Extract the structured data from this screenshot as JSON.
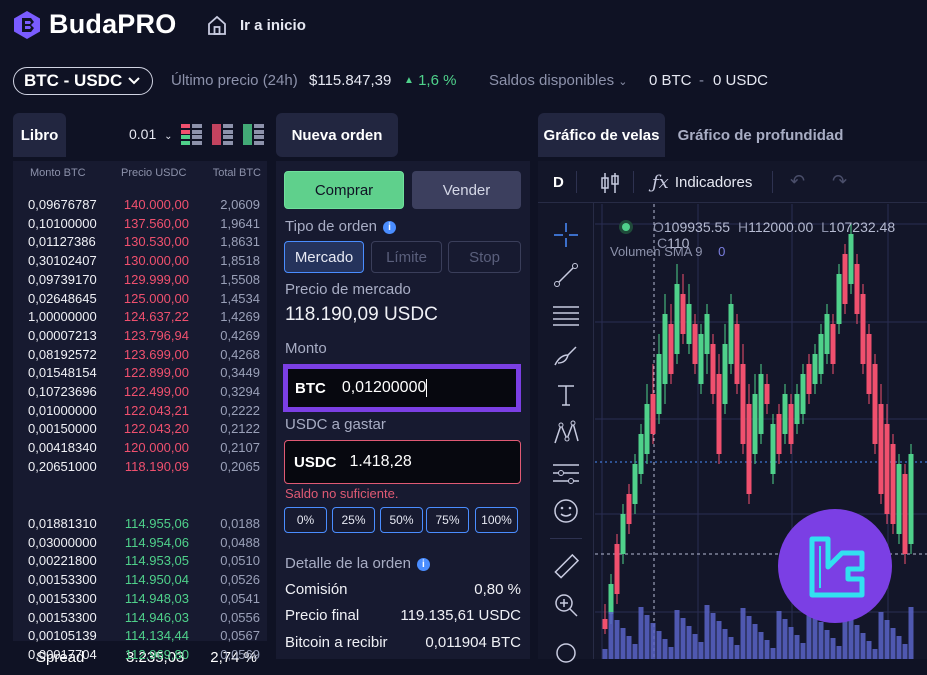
{
  "header": {
    "brand": "BudaPRO",
    "home_label": "Ir a inicio"
  },
  "market": {
    "pair": "BTC - USDC",
    "last_price_label": "Último precio (24h)",
    "last_price": "$115.847,39",
    "change": "1,6 %",
    "balances_label": "Saldos disponibles",
    "balance_btc": "0 BTC",
    "separator": "-",
    "balance_usdc": "0 USDC"
  },
  "book": {
    "tab": "Libro",
    "precision": "0.01",
    "columns": [
      "Monto BTC",
      "Precio USDC",
      "Total BTC"
    ],
    "asks": [
      [
        "0,09676787",
        "140.000,00",
        "2,0609"
      ],
      [
        "0,10100000",
        "137.560,00",
        "1,9641"
      ],
      [
        "0,01127386",
        "130.530,00",
        "1,8631"
      ],
      [
        "0,30102407",
        "130.000,00",
        "1,8518"
      ],
      [
        "0,09739170",
        "129.999,00",
        "1,5508"
      ],
      [
        "0,02648645",
        "125.000,00",
        "1,4534"
      ],
      [
        "1,00000000",
        "124.637,22",
        "1,4269"
      ],
      [
        "0,00007213",
        "123.796,94",
        "0,4269"
      ],
      [
        "0,08192572",
        "123.699,00",
        "0,4268"
      ],
      [
        "0,01548154",
        "122.899,00",
        "0,3449"
      ],
      [
        "0,10723696",
        "122.499,00",
        "0,3294"
      ],
      [
        "0,01000000",
        "122.043,21",
        "0,2222"
      ],
      [
        "0,00150000",
        "122.043,20",
        "0,2122"
      ],
      [
        "0,00418340",
        "120.000,00",
        "0,2107"
      ],
      [
        "0,20651000",
        "118.190,09",
        "0,2065"
      ]
    ],
    "spread_label": "Spread",
    "spread_value": "3.235,03",
    "spread_pct": "2,74 %",
    "bids": [
      [
        "0,01881310",
        "114.955,06",
        "0,0188"
      ],
      [
        "0,03000000",
        "114.954,06",
        "0,0488"
      ],
      [
        "0,00221800",
        "114.953,05",
        "0,0510"
      ],
      [
        "0,00153300",
        "114.950,04",
        "0,0526"
      ],
      [
        "0,00153300",
        "114.948,03",
        "0,0541"
      ],
      [
        "0,00153300",
        "114.946,03",
        "0,0556"
      ],
      [
        "0,00105139",
        "114.134,44",
        "0,0567"
      ],
      [
        "0,00017704",
        "112.969,80",
        "0,0569"
      ]
    ]
  },
  "order": {
    "tab": "Nueva orden",
    "buy": "Comprar",
    "sell": "Vender",
    "type_label": "Tipo de orden",
    "types": [
      "Mercado",
      "Límite",
      "Stop"
    ],
    "market_price_label": "Precio de mercado",
    "market_price": "118.190,09 USDC",
    "amount_label": "Monto",
    "amount_currency": "BTC",
    "amount_value": "0,01200000",
    "spend_label": "USDC a gastar",
    "spend_currency": "USDC",
    "spend_value": "1.418,28",
    "error": "Saldo no suficiente.",
    "percents": [
      "0%",
      "25%",
      "50%",
      "75%",
      "100%"
    ],
    "detail_label": "Detalle de la orden",
    "details": [
      {
        "label": "Comisión",
        "value": "0,80 %"
      },
      {
        "label": "Precio final",
        "value": "119.135,61 USDC"
      },
      {
        "label": "Bitcoin a recibir",
        "value": "0,011904 BTC"
      }
    ]
  },
  "chart": {
    "tabs": [
      "Gráfico de velas",
      "Gráfico de profundidad"
    ],
    "interval": "D",
    "indicators": "Indicadores",
    "ohlc": {
      "o_label": "O",
      "o": "109935.55",
      "h_label": "H",
      "h": "112000.00",
      "l_label": "L",
      "l": "107232.48",
      "c_label": "C",
      "c": "110"
    },
    "volume_label": "Volumen SMA 9",
    "volume_value": "0",
    "colors": {
      "up": "#4fd18b",
      "down": "#f0506e",
      "volume": "#5b64c8"
    }
  }
}
